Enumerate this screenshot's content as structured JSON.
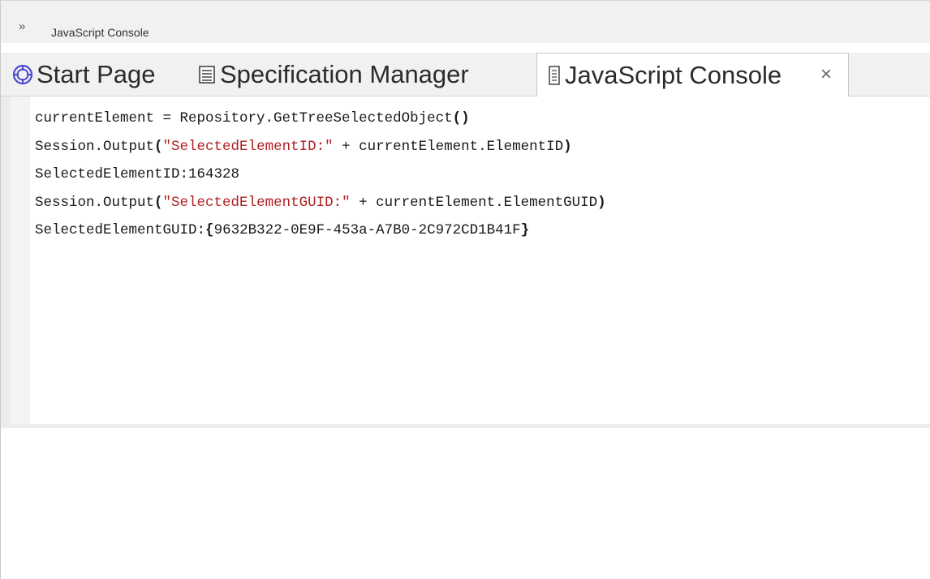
{
  "window": {
    "title": "JavaScript Console",
    "chevron": "»"
  },
  "tabs": [
    {
      "label": "Start Page",
      "icon": "start-page-icon",
      "active": false
    },
    {
      "label": "Specification Manager",
      "icon": "specification-manager-icon",
      "active": false
    },
    {
      "label": "JavaScript Console",
      "icon": "javascript-console-icon",
      "active": true,
      "close": "×"
    }
  ],
  "console": {
    "lines": [
      {
        "parts": [
          {
            "text": "currentElement = Repository.GetTreeSelectedObject",
            "kind": "plain"
          },
          {
            "text": "()",
            "kind": "paren"
          }
        ]
      },
      {
        "parts": [
          {
            "text": "Session.Output",
            "kind": "plain"
          },
          {
            "text": "(",
            "kind": "paren"
          },
          {
            "text": "\"SelectedElementID:\"",
            "kind": "str"
          },
          {
            "text": " + currentElement.ElementID",
            "kind": "plain"
          },
          {
            "text": ")",
            "kind": "paren"
          }
        ]
      },
      {
        "parts": [
          {
            "text": "SelectedElementID:164328",
            "kind": "plain"
          }
        ]
      },
      {
        "parts": [
          {
            "text": "Session.Output",
            "kind": "plain"
          },
          {
            "text": "(",
            "kind": "paren"
          },
          {
            "text": "\"SelectedElementGUID:\"",
            "kind": "str"
          },
          {
            "text": " + currentElement.ElementGUID",
            "kind": "plain"
          },
          {
            "text": ")",
            "kind": "paren"
          }
        ]
      },
      {
        "parts": [
          {
            "text": "SelectedElementGUID:",
            "kind": "plain"
          },
          {
            "text": "{",
            "kind": "paren"
          },
          {
            "text": "9632B322-0E9F-453a-A7B0-2C972CD1B41F",
            "kind": "plain"
          },
          {
            "text": "}",
            "kind": "paren"
          }
        ]
      }
    ]
  },
  "colors": {
    "string": "#b02020",
    "tab_strip": "#f1f1f1",
    "start_icon": "#4a4ad0"
  }
}
